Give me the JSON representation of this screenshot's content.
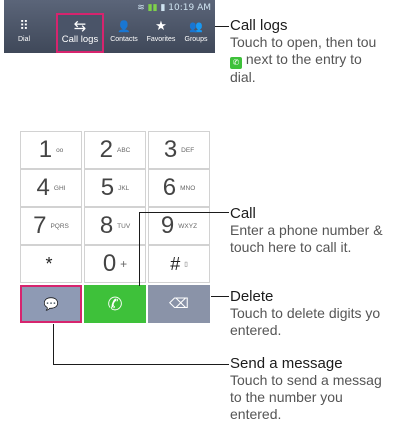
{
  "status": {
    "time": "10:19 AM",
    "icons": "wifi, signal, battery"
  },
  "tabs": [
    {
      "label": "Dial",
      "icon": "grid-icon",
      "glyph": "⠿"
    },
    {
      "label": "Call logs",
      "icon": "call-logs-icon",
      "glyph": "⇆"
    },
    {
      "label": "Contacts",
      "icon": "contacts-icon",
      "glyph": "👤"
    },
    {
      "label": "Favorites",
      "icon": "star-icon",
      "glyph": "★"
    },
    {
      "label": "Groups",
      "icon": "groups-icon",
      "glyph": "👥"
    }
  ],
  "keys": [
    {
      "digit": "1",
      "sub": "oo"
    },
    {
      "digit": "2",
      "sub": "ABC"
    },
    {
      "digit": "3",
      "sub": "DEF"
    },
    {
      "digit": "4",
      "sub": "GHI"
    },
    {
      "digit": "5",
      "sub": "JKL"
    },
    {
      "digit": "6",
      "sub": "MNO"
    },
    {
      "digit": "7",
      "sub": "PQRS"
    },
    {
      "digit": "8",
      "sub": "TUV"
    },
    {
      "digit": "9",
      "sub": "WXYZ"
    },
    {
      "digit": "*",
      "sub": ""
    },
    {
      "digit": "0",
      "sub": "+"
    },
    {
      "digit": "#",
      "sub": "▯"
    }
  ],
  "actions": {
    "message_glyph": "💬",
    "call_glyph": "✆",
    "delete_glyph": "⌫"
  },
  "callouts": {
    "call_logs": {
      "title": "Call logs",
      "line1": "Touch to open, then tou",
      "line2": " next to the entry to",
      "line3": "dial."
    },
    "call": {
      "title": "Call",
      "line1": "Enter a phone number &",
      "line2": "touch here to call it."
    },
    "delete": {
      "title": "Delete",
      "line1": "Touch to delete digits yo",
      "line2": "entered."
    },
    "send": {
      "title": "Send a message",
      "line1": "Touch to send a messag",
      "line2": "to the number you",
      "line3": "entered."
    }
  },
  "colors": {
    "accent": "#d6246e",
    "call_green": "#3ec13a",
    "bar": "#4a5468"
  }
}
